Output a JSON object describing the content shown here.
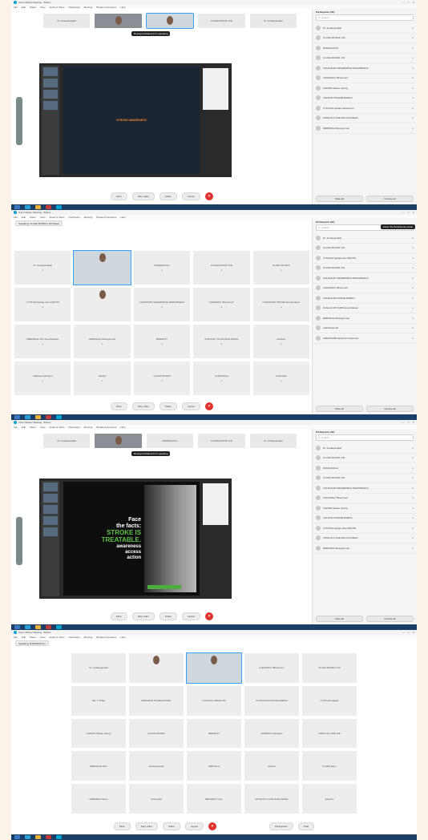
{
  "window": {
    "app_title": "Cisco Webex Meeting",
    "tab_label": "Webex",
    "menu": [
      "File",
      "Edit",
      "Share",
      "View",
      "Audio & Video",
      "Participant",
      "Meeting",
      "Breakout Sessions",
      "Help"
    ],
    "controls": [
      "—",
      "□",
      "✕"
    ]
  },
  "participants_panel": {
    "header": "Participants (20)",
    "search_placeholder": "Search",
    "tooltip": "Close the Participants panel",
    "mute_all": "Mute all",
    "unmute_all": "Unmute all",
    "names_shot1": [
      "Dr. Anakayanakal",
      "CLANA MOSINI LISI",
      "RAMANAKALI",
      "CLANA MUSINI LISI",
      "CHUKWUDI SEGEBORUE DEROMKEHU",
      "CHIAMAKA \"Bluecross\"",
      "CHIOMA Waste Jatong",
      "CHUKWU PRAISE EMEKA",
      "CYNTHIA Agbaje Adetowomi",
      "OMOLOLU ADE IKE KOCKMAN",
      "DEBORAH Mosegumuel"
    ],
    "names_shot2": [
      "Dr. Anakayanakal",
      "CLANA MUSINI LISI",
      "CYNTHIA Agbaje Alex ARSTIN",
      "CLANA MUSINI LISI",
      "CHUKWUDI SEGEBORUE DEROMKEHU",
      "CHIAMAKA \"Bluecross\"",
      "CHUKWUDI PRAISE EMEKA",
      "Deborah APC MRS Aina Adeleke",
      "DEBORAH Mosegumuel",
      "Adebolsaunde",
      "ADEWUMMI Akinkunmi Ademola"
    ],
    "names_shot3": [
      "Dr. Anakayanakal",
      "CLANA MUSINI LISI",
      "RAMANAKALI",
      "CLANA MUSINI LISI",
      "CHUKWUDI SEGEBORUE DEROMKEHU",
      "CHIAMAKA \"Bluecross\"",
      "CHIOMA Waste Jatong",
      "CHUKWU PRAISE EMEKA",
      "CYNTHIA Agbaje Alex ARSTIN",
      "OMOLOLU ADE IKE KOCKMAN",
      "DEBORAH Mosegumuel"
    ]
  },
  "meeting_bar": {
    "mute": "Mute",
    "stop_video": "Stop video",
    "share": "Share",
    "participants": "Participants",
    "chat": "Chat",
    "layout": "Layout"
  },
  "shot1": {
    "thumbs": [
      "Dr. Anakayanakal",
      "RAMANAKALI",
      "CLANA MUSINI LISI",
      "Dr. Anakayanakal"
    ],
    "tooltip": "Roselynd Adekumbi is speaking",
    "slide_title": "STROKE AWARENESS"
  },
  "shot2": {
    "banner": "Speaking: CLANA MUSINI LISI Nwaet",
    "cells": [
      "Dr. Anakayanakal",
      "RAMANAKALI",
      "CLANA MUSINI LISI",
      "CLANA MOSINI",
      "CYNTHIA Agbaje Alex ARSTIN",
      "CHUKWUDI SEGEBORUE DEROMKEHU",
      "CHIAMAKA \"Bluecross\"",
      "CHUKWUDI PRAISE Emeka Ikeze",
      "DEBORAH APC Aina Adeleke",
      "DEBORAH Mosegumuel",
      "BENNETT",
      "ANTHONY OLAKUNLE ISMAIL",
      "Adebolu",
      "Adebayo Adebayo",
      "Adebiyi",
      "CLANA MUSINI",
      "CLARA Ekpo",
      "Chiamaka"
    ]
  },
  "shot3": {
    "thumbs": [
      "Dr. Anakayanakal",
      "RAMANAKALI",
      "CLANA MUSINI LISI",
      "Dr. Anakayanakal"
    ],
    "tooltip": "Roselynd Adekumbi is speaking",
    "poster_line1": "Face",
    "poster_line2": "the facts:",
    "poster_line3": "STROKE IS",
    "poster_line4": "TREATABLE.",
    "poster_line5": "awareness",
    "poster_line6": "access",
    "poster_line7": "action"
  },
  "shot4": {
    "banner": "Speaking: RAMANAKALI",
    "cells": [
      "Dr. Anakayanakal",
      "CHIAMAKA \"Bluecross\"",
      "CLANA MUSINI LISI",
      "DR. T. OWA",
      "DEBORAH MOSEGUMUEL",
      "CHUKWU ABSOLOM",
      "CHUKWUDI PRAISE EMEKA",
      "CYNTHIA Agbaje",
      "CHIOMA Waste Jatong",
      "CLANA MUSINI",
      "BENNETT",
      "ADEBAYO Adebayo",
      "OMOLOLU ADE IKE",
      "DEBORAH APC",
      "Adebolsaunde",
      "MRS Aina",
      "Adebiyi",
      "CLARA Ekpo",
      "DEBORAH Mose",
      "Chiamaka",
      "BENNETT Ovie",
      "ANTHONY OLAKUNLE ISMAIL",
      "Adebolu",
      "Babajo Minahosa"
    ]
  }
}
